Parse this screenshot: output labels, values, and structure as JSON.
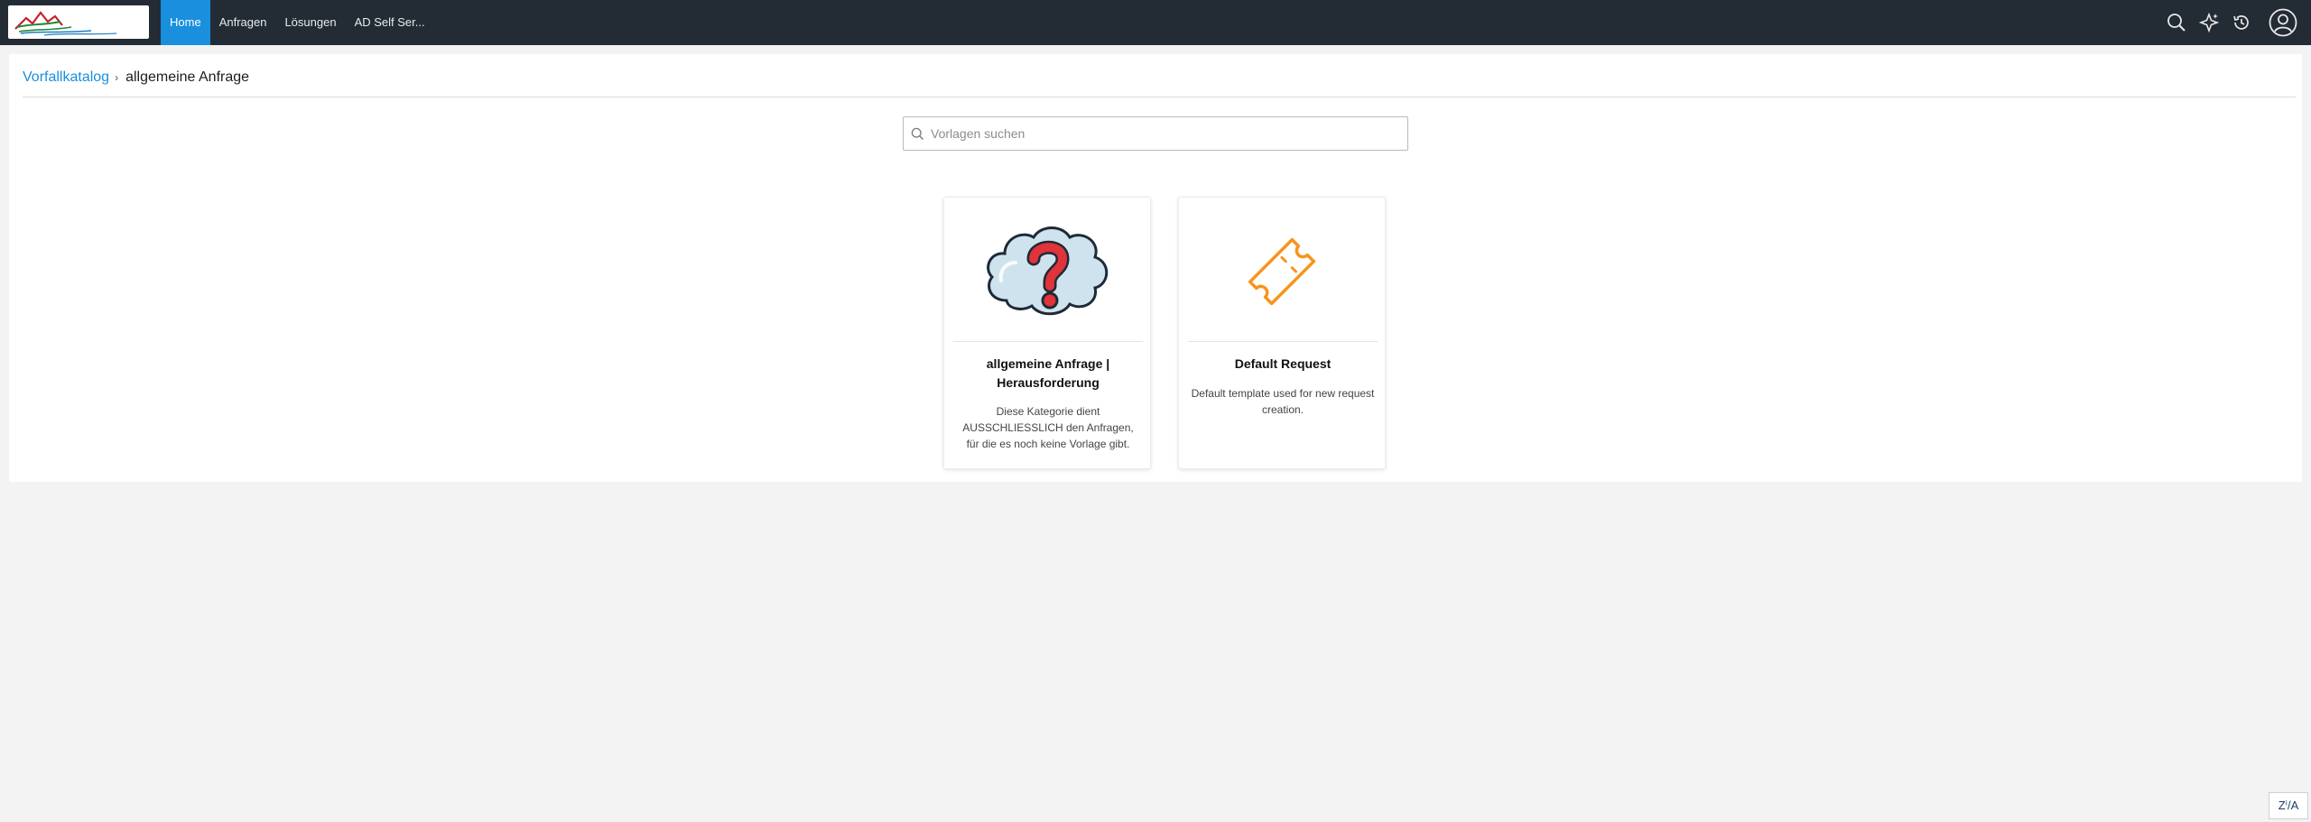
{
  "nav": {
    "items": [
      {
        "label": "Home",
        "active": true
      },
      {
        "label": "Anfragen",
        "active": false
      },
      {
        "label": "Lösungen",
        "active": false
      },
      {
        "label": "AD Self Ser...",
        "active": false
      }
    ]
  },
  "topbar_icons": [
    "search-icon",
    "sparkle-icon",
    "history-icon",
    "user-avatar-icon"
  ],
  "breadcrumb": {
    "parent": "Vorfallkatalog",
    "separator": "›",
    "current": "allgemeine Anfrage"
  },
  "search": {
    "placeholder": "Vorlagen suchen",
    "value": ""
  },
  "cards": [
    {
      "icon": "question-cloud-icon",
      "title": "allgemeine Anfrage | Herausforderung",
      "description": "Diese Kategorie dient AUSSCHLIESSLICH den Anfragen, für die es noch keine Vorlage gibt."
    },
    {
      "icon": "ticket-icon",
      "title": "Default Request",
      "description": "Default template used for new request creation."
    }
  ],
  "corner_button": {
    "label": "Zⁱ/A"
  },
  "colors": {
    "topbar": "#232b35",
    "accent": "#1a8fdd",
    "page_bg": "#f3f3f3",
    "ticket_orange": "#f7941d"
  }
}
